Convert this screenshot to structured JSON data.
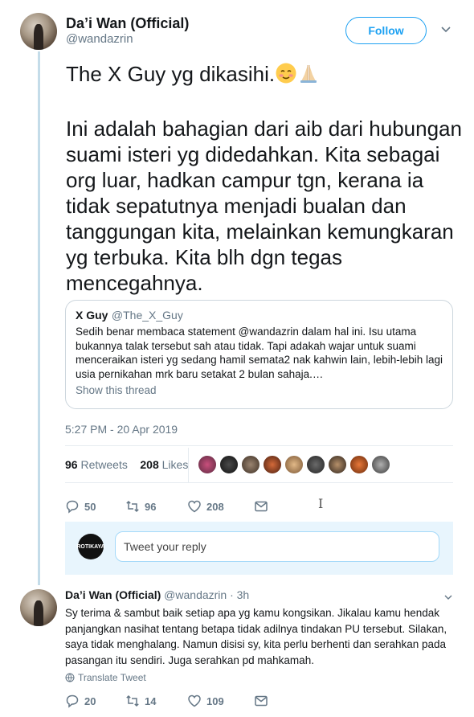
{
  "main_tweet": {
    "author_name": "Da’i Wan (Official)",
    "author_handle": "@wandazrin",
    "follow_label": "Follow",
    "paragraph1": "The X Guy yg dikasihi.",
    "paragraph2": "Ini adalah bahagian dari aib dari hubungan suami isteri yg didedahkan. Kita sebagai org luar, hadkan campur tgn, kerana ia tidak sepatutnya menjadi bualan dan tanggungan kita, melainkan kemungkaran yg terbuka. Kita blh dgn tegas mencegahnya.",
    "quoted": {
      "name": "X Guy",
      "handle": "@The_X_Guy",
      "text": "Sedih benar membaca statement @wandazrin dalam hal ini. Isu utama bukannya talak tersebut sah atau tidak. Tapi adakah wajar untuk suami menceraikan isteri yg sedang hamil semata2 nak kahwin lain, lebih-lebih lagi usia pernikahan mrk baru setakat 2 bulan sahaja.…",
      "show_thread": "Show this thread"
    },
    "timestamp": "5:27 PM - 20 Apr 2019",
    "retweets_count": "96",
    "retweets_label": "Retweets",
    "likes_count": "208",
    "likes_label": "Likes",
    "actions": {
      "replies": "50",
      "retweets": "96",
      "likes": "208"
    }
  },
  "reply_box": {
    "avatar_text": "ROTIKAYA",
    "placeholder": "Tweet your reply"
  },
  "reply_tweet": {
    "author_name": "Da’i Wan (Official)",
    "meta": "@wandazrin · 3h",
    "text": "Sy terima & sambut baik setiap apa yg kamu kongsikan. Jikalau kamu hendak panjangkan nasihat tentang betapa tidak adilnya tindakan PU tersebut. Silakan, saya tidak menghalang. Namun disisi sy, kita perlu berhenti dan serahkan pada pasangan itu sendiri. Juga serahkan pd mahkamah.",
    "translate_label": "Translate Tweet",
    "actions": {
      "replies": "20",
      "retweets": "14",
      "likes": "109"
    }
  },
  "colors": {
    "accent": "#1da1f2",
    "muted": "#657786",
    "thread_line": "#c4dce9",
    "reply_bg": "#e8f5fd"
  },
  "icons": [
    "chevron-down-icon",
    "smiling-face-icon",
    "folded-hands-icon",
    "reply-icon",
    "retweet-icon",
    "heart-icon",
    "message-icon",
    "globe-icon"
  ]
}
